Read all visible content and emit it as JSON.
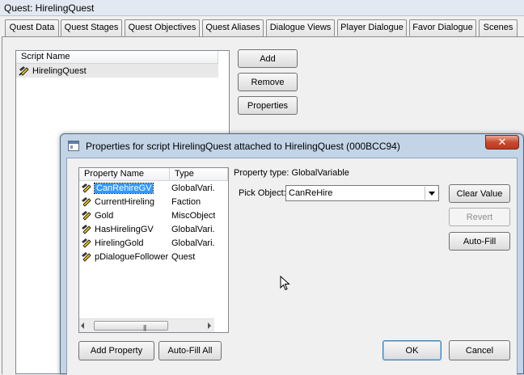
{
  "window": {
    "title": "Quest: HirelingQuest"
  },
  "tabs": [
    {
      "label": "Quest Data"
    },
    {
      "label": "Quest Stages"
    },
    {
      "label": "Quest Objectives"
    },
    {
      "label": "Quest Aliases"
    },
    {
      "label": "Dialogue Views"
    },
    {
      "label": "Player Dialogue"
    },
    {
      "label": "Favor Dialogue"
    },
    {
      "label": "Scenes"
    }
  ],
  "scripts_panel": {
    "column_header": "Script Name",
    "items": [
      {
        "name": "HirelingQuest"
      }
    ],
    "buttons": {
      "add": "Add",
      "remove": "Remove",
      "properties": "Properties"
    }
  },
  "dialog": {
    "title": "Properties for script HirelingQuest attached to HirelingQuest (000BCC94)",
    "close_glyph": "✕",
    "columns": {
      "name": "Property Name",
      "type": "Type"
    },
    "properties": [
      {
        "name": "CanRehireGV",
        "type": "GlobalVari..."
      },
      {
        "name": "CurrentHireling",
        "type": "Faction"
      },
      {
        "name": "Gold",
        "type": "MiscObject"
      },
      {
        "name": "HasHirelingGV",
        "type": "GlobalVari..."
      },
      {
        "name": "HirelingGold",
        "type": "GlobalVari..."
      },
      {
        "name": "pDialogueFollower",
        "type": "Quest"
      }
    ],
    "scroll_grip": "|||",
    "property_type_text": "Property type: GlobalVariable",
    "pick_label": "Pick Object:",
    "pick_value": "CanReHire",
    "buttons": {
      "clear_value": "Clear Value",
      "revert": "Revert",
      "auto_fill": "Auto-Fill",
      "add_property": "Add Property",
      "auto_fill_all": "Auto-Fill All",
      "ok": "OK",
      "cancel": "Cancel"
    }
  },
  "colors": {
    "selection": "#3399ff",
    "dialog_frame": "#c3d4e7",
    "close_button": "#c74a2f"
  }
}
